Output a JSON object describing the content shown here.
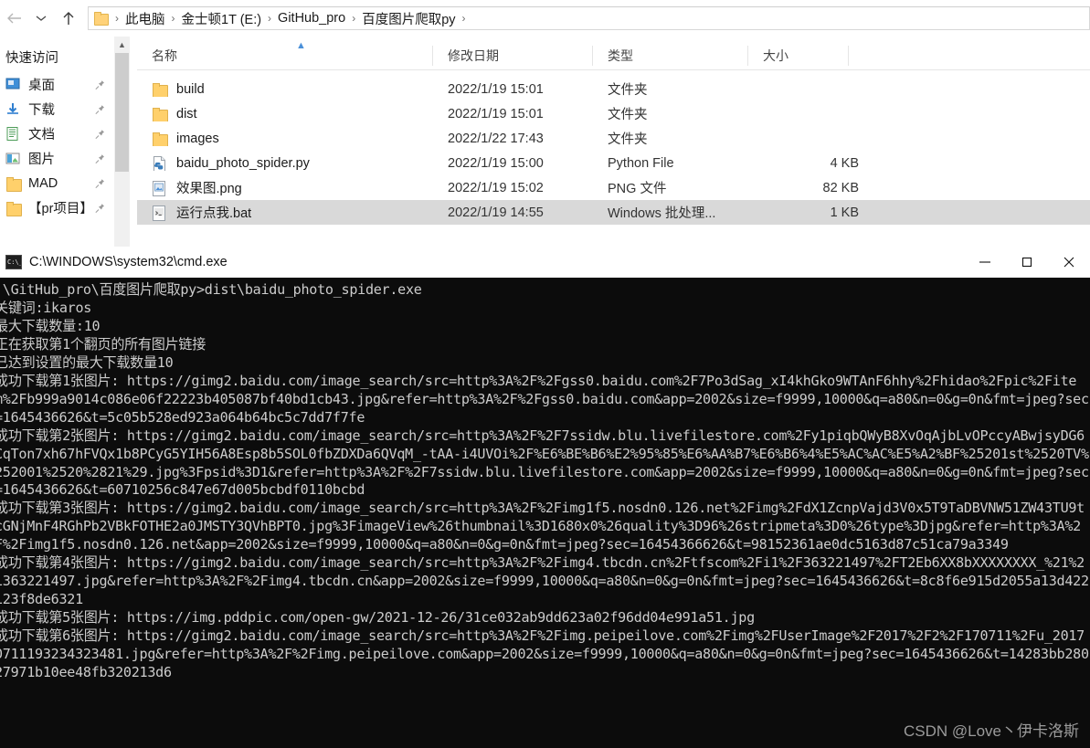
{
  "explorer": {
    "nav": {
      "back_icon": "arrow-left-icon",
      "forward_icon": "arrow-right-icon",
      "recent_icon": "chevron-down-icon",
      "up_icon": "arrow-up-icon"
    },
    "breadcrumb": {
      "folder_icon": "folder-icon",
      "separator": "›",
      "items": [
        "此电脑",
        "金士顿1T (E:)",
        "GitHub_pro",
        "百度图片爬取py"
      ]
    },
    "sidebar": {
      "header": "快速访问",
      "pin_icon": "pin-icon",
      "items": [
        {
          "label": "桌面",
          "icon": "desktop-icon",
          "pinned": true
        },
        {
          "label": "下载",
          "icon": "downloads-icon",
          "pinned": true
        },
        {
          "label": "文档",
          "icon": "documents-icon",
          "pinned": true
        },
        {
          "label": "图片",
          "icon": "pictures-icon",
          "pinned": true
        },
        {
          "label": "MAD",
          "icon": "folder-icon",
          "pinned": true
        },
        {
          "label": "【pr项目】",
          "icon": "folder-icon",
          "pinned": true
        }
      ]
    },
    "columns": {
      "name": "名称",
      "date": "修改日期",
      "type": "类型",
      "size": "大小",
      "sort_caret_icon": "caret-up-icon"
    },
    "files": [
      {
        "name": "build",
        "icon": "folder-icon",
        "date": "2022/1/19 15:01",
        "type": "文件夹",
        "size": "",
        "selected": false
      },
      {
        "name": "dist",
        "icon": "folder-icon",
        "date": "2022/1/19 15:01",
        "type": "文件夹",
        "size": "",
        "selected": false
      },
      {
        "name": "images",
        "icon": "folder-icon",
        "date": "2022/1/22 17:43",
        "type": "文件夹",
        "size": "",
        "selected": false
      },
      {
        "name": "baidu_photo_spider.py",
        "icon": "python-file-icon",
        "date": "2022/1/19 15:00",
        "type": "Python File",
        "size": "4 KB",
        "selected": false
      },
      {
        "name": "效果图.png",
        "icon": "png-file-icon",
        "date": "2022/1/19 15:02",
        "type": "PNG 文件",
        "size": "82 KB",
        "selected": false
      },
      {
        "name": "运行点我.bat",
        "icon": "bat-file-icon",
        "date": "2022/1/19 14:55",
        "type": "Windows 批处理...",
        "size": "1 KB",
        "selected": true
      }
    ]
  },
  "console": {
    "title": "C:\\WINDOWS\\system32\\cmd.exe",
    "title_icon": "cmd-icon",
    "window_controls": {
      "minimize_icon": "minimize-icon",
      "maximize_icon": "maximize-icon",
      "close_icon": "close-icon"
    },
    "output": ":\\GitHub_pro\\百度图片爬取py>dist\\baidu_photo_spider.exe\n关键词:ikaros\n最大下载数量:10\n正在获取第1个翻页的所有图片链接\n已达到设置的最大下载数量10\n成功下载第1张图片: https://gimg2.baidu.com/image_search/src=http%3A%2F%2Fgss0.baidu.com%2F7Po3dSag_xI4khGko9WTAnF6hhy%2Fhidao%2Fpic%2Fitem%2Fb999a9014c086e06f22223b405087bf40bd1cb43.jpg&refer=http%3A%2F%2Fgss0.baidu.com&app=2002&size=f9999,10000&q=a80&n=0&g=0n&fmt=jpeg?sec=1645436626&t=5c05b528ed923a064b64bc5c7dd7f7fe\n成功下载第2张图片: https://gimg2.baidu.com/image_search/src=http%3A%2F%2F7ssidw.blu.livefilestore.com%2Fy1piqbQWyB8XvOqAjbLvOPccyABwjsyDG6CqTon7xh67hFVQx1b8PCyG5YIH56A8Esp8b5SOL0fbZDXDa6QVqM_-tAA-i4UVOi%2F%E6%BE%B6%E2%95%85%E6%AA%B7%E6%B6%4%E5%AC%AC%E5%A2%BF%25201st%2520TV%252001%2520%2821%29.jpg%3Fpsid%3D1&refer=http%3A%2F%2F7ssidw.blu.livefilestore.com&app=2002&size=f9999,10000&q=a80&n=0&g=0n&fmt=jpeg?sec=1645436626&t=60710256c847e67d005bcbdf0110bcbd\n成功下载第3张图片: https://gimg2.baidu.com/image_search/src=http%3A%2F%2Fimg1f5.nosdn0.126.net%2Fimg%2FdX1ZcnpVajd3V0x5T9TaDBVNW51ZW43TU9tcGNjMnF4RGhPb2VBkFOTHE2a0JMSTY3QVhBPT0.jpg%3FimageView%26thumbnail%3D1680x0%26quality%3D96%26stripmeta%3D0%26type%3Djpg&refer=http%3A%2F%2Fimg1f5.nosdn0.126.net&app=2002&size=f9999,10000&q=a80&n=0&g=0n&fmt=jpeg?sec=16454366626&t=98152361ae0dc5163d87c51ca79a3349\n成功下载第4张图片: https://gimg2.baidu.com/image_search/src=http%3A%2F%2Fimg4.tbcdn.cn%2Ftfscom%2Fi1%2F363221497%2FT2Eb6XX8bXXXXXXXX_%21%21363221497.jpg&refer=http%3A%2F%2Fimg4.tbcdn.cn&app=2002&size=f9999,10000&q=a80&n=0&g=0n&fmt=jpeg?sec=1645436626&t=8c8f6e915d2055a13d422123f8de6321\n成功下载第5张图片: https://img.pddpic.com/open-gw/2021-12-26/31ce032ab9dd623a02f96dd04e991a51.jpg\n成功下载第6张图片: https://gimg2.baidu.com/image_search/src=http%3A%2F%2Fimg.peipeilove.com%2Fimg%2FUserImage%2F2017%2F2%2F170711%2Fu_20170711193234323481.jpg&refer=http%3A%2F%2Fimg.peipeilove.com&app=2002&size=f9999,10000&q=a80&n=0&g=0n&fmt=jpeg?sec=1645436626&t=14283bb28027971b10ee48fb320213d6",
    "watermark": "CSDN @Love丶伊卡洛斯"
  },
  "colors": {
    "console_bg": "#0c0c0c",
    "console_fg": "#cccccc",
    "selection": "#d9d9d9",
    "folder": "#ffd06b",
    "accent": "#4a90d9"
  }
}
